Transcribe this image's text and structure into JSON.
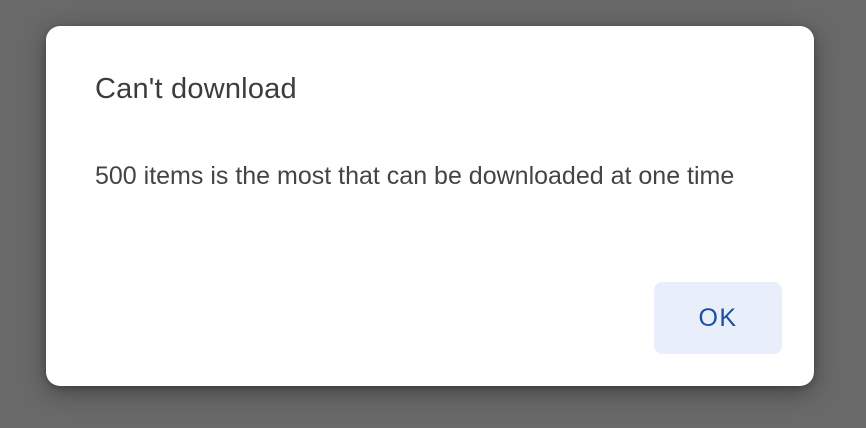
{
  "dialog": {
    "title": "Can't download",
    "message": "500 items is the most that can be downloaded at one time",
    "ok_label": "OK"
  },
  "colors": {
    "backdrop": "#696969",
    "dialog_background": "#ffffff",
    "button_background": "#e8effa",
    "button_text": "#1a4fa3"
  }
}
